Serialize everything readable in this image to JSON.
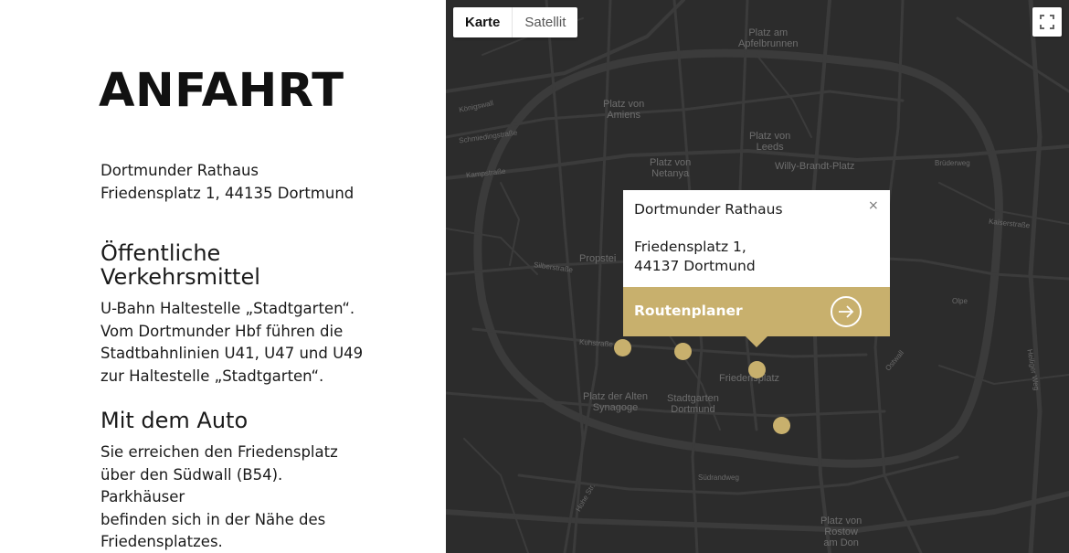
{
  "left": {
    "title": "ANFAHRT",
    "address_line1": "Dortmunder Rathaus",
    "address_line2": "Friedensplatz 1, 44135 Dortmund",
    "oev_heading_line1": "Öffentliche",
    "oev_heading_line2": "Verkehrsmittel",
    "oev_text": [
      "U-Bahn Haltestelle „Stadtgarten“.",
      "Vom Dortmunder Hbf führen die",
      "Stadtbahnlinien U41, U47 und U49",
      "zur Haltestelle „Stadtgarten“."
    ],
    "auto_heading": "Mit dem Auto",
    "auto_text": [
      "Sie erreichen den Friedensplatz",
      "über den Südwall (B54). Parkhäuser",
      "befinden sich in der Nähe des",
      "Friedensplatzes."
    ]
  },
  "map": {
    "type_control": {
      "map_label": "Karte",
      "satellite_label": "Satellit"
    },
    "fullscreen_icon": "fullscreen-icon",
    "colors": {
      "background": "#2c2c2c",
      "road": "#3c3c3c",
      "pin": "#c8b06d",
      "label": "#6e6e6e"
    },
    "labels": {
      "platz_am_apfelbrunnen": [
        "Platz am",
        "Apfelbrunnen"
      ],
      "platz_von_amiens": [
        "Platz von",
        "Amiens"
      ],
      "platz_von_leeds": [
        "Platz von",
        "Leeds"
      ],
      "platz_von_netanya": [
        "Platz von",
        "Netanya"
      ],
      "willy_brandt_platz": "Willy-Brandt-Platz",
      "propstei": "Propstei",
      "friedensplatz": "Friedensplatz",
      "platz_der_alten_synagoge": [
        "Platz der Alten",
        "Synagoge"
      ],
      "stadtgarten_dortmund": [
        "Stadtgarten",
        "Dortmund"
      ],
      "platz_von_rostow": [
        "Platz von",
        "Rostow",
        "am Don"
      ],
      "small": [
        "Königswall",
        "Schmiedingstraße",
        "Kampstraße",
        "Silberstraße",
        "Kuhstraße",
        "Hohe Str.",
        "Südwall",
        "Burgwall",
        "Brückstraße",
        "Kleppingstraße",
        "Ostwall",
        "Südrandweg",
        "Heiliger Weg",
        "Olpe",
        "Kaiserstraße",
        "Brüderweg",
        "Berliner Tor",
        "Hansastraße",
        "Karlplatz",
        "Prinzenstraße"
      ]
    },
    "info_window": {
      "name": "Dortmunder Rathaus",
      "street_line1": "Friedensplatz 1,",
      "street_line2": "44137 Dortmund",
      "route_label": "Routenplaner",
      "close_label": "×"
    }
  }
}
